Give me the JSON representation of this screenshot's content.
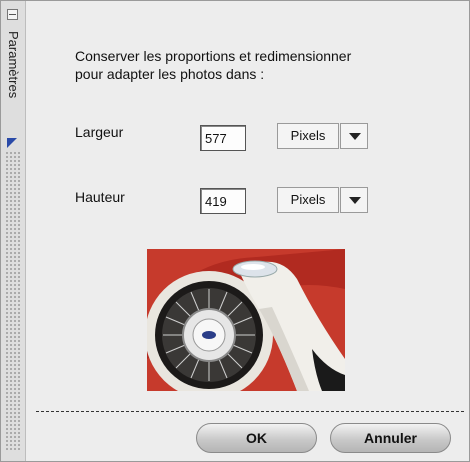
{
  "sidebar": {
    "title": "Paramètres"
  },
  "resize": {
    "description": "Conserver les proportions et redimensionner pour adapter les photos dans :",
    "width": {
      "label": "Largeur",
      "value": "577",
      "unit": "Pixels"
    },
    "height": {
      "label": "Hauteur",
      "value": "419",
      "unit": "Pixels"
    }
  },
  "preview": {
    "icon": "car-wheel-photo"
  },
  "buttons": {
    "ok": "OK",
    "cancel": "Annuler"
  }
}
